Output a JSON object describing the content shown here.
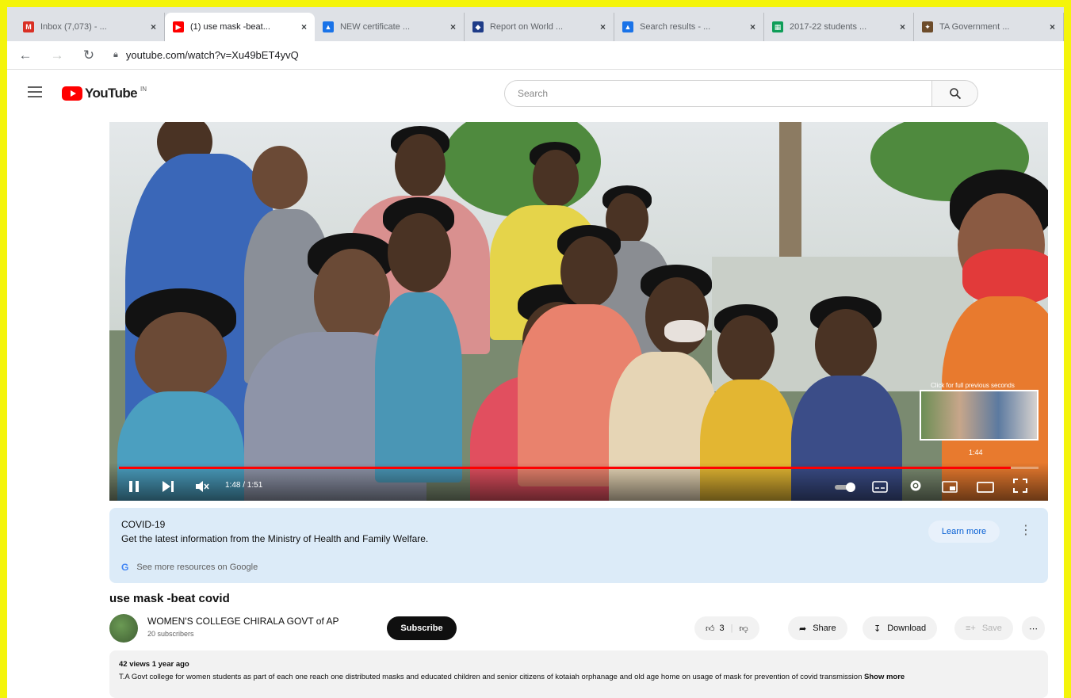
{
  "browser": {
    "tabs": [
      {
        "title": "Inbox (7,073) - ...",
        "favicon": "gmail-icon",
        "color": "#d93025",
        "active": false
      },
      {
        "title": "(1) use mask -beat...",
        "favicon": "youtube-icon",
        "color": "#ff0000",
        "active": true
      },
      {
        "title": "NEW certificate ...",
        "favicon": "drive-icon",
        "color": "#1a73e8",
        "active": false
      },
      {
        "title": "Report on World ...",
        "favicon": "shield-icon",
        "color": "#1f3c88",
        "active": false
      },
      {
        "title": "Search results - ...",
        "favicon": "drive-icon",
        "color": "#1a73e8",
        "active": false
      },
      {
        "title": "2017-22 students ...",
        "favicon": "sheets-icon",
        "color": "#0f9d58",
        "active": false
      },
      {
        "title": "TA Government ...",
        "favicon": "emblem-icon",
        "color": "#6d4c2b",
        "active": false
      }
    ],
    "url": "youtube.com/watch?v=Xu49bET4yvQ"
  },
  "youtube": {
    "logo_text": "YouTube",
    "logo_sup": "IN",
    "search_placeholder": "Search"
  },
  "player": {
    "timecode": "1:48 / 1:51",
    "progress": 0.97,
    "preview_caption": "Click for full previous seconds",
    "preview_time": "1:44"
  },
  "covid": {
    "heading": "COVID-19",
    "text": "Get the latest information from the Ministry of Health and Family Welfare.",
    "learn_more": "Learn more",
    "google_link": "See more resources on Google"
  },
  "video": {
    "title": "use mask -beat covid",
    "channel": "WOMEN'S COLLEGE CHIRALA GOVT of AP",
    "subscribers": "20 subscribers",
    "subscribe_label": "Subscribe",
    "likes": "3",
    "share_label": "Share",
    "download_label": "Download",
    "save_label": "Save",
    "views_date": "42 views  1 year ago",
    "description": "T.A Govt college for women students as part of each one reach one  distributed masks and educated children and senior citizens of kotaiah orphanage and old age home on usage of mask for prevention of covid transmission",
    "show_more": "Show more"
  }
}
